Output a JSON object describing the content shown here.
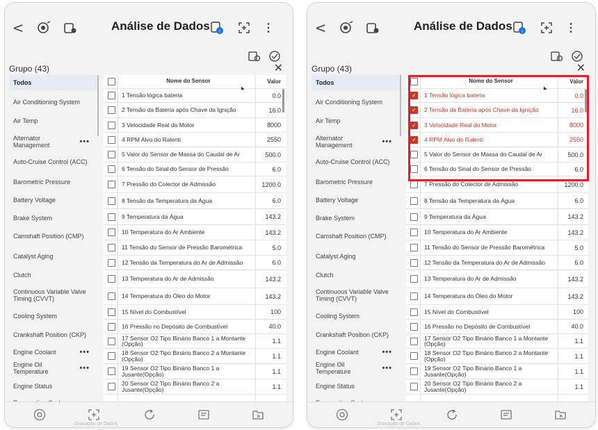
{
  "app": {
    "title": "Análise de Dados",
    "back_glyph": "<",
    "menu_glyph": "⋮",
    "close_glyph": "✕",
    "expand_glyph": "[+]",
    "group_label": "Grupo (43)",
    "icons": [
      "back-arrow-icon",
      "vci-connection-icon",
      "vehicle-info-icon",
      "document-info-icon",
      "fullscreen-icon",
      "more-menu-icon",
      "record-icon",
      "snapshot-icon",
      "close-icon"
    ]
  },
  "sidebar": {
    "items": [
      {
        "label": "Todos",
        "active": true
      },
      {
        "label": "Air Conditioning System"
      },
      {
        "label": "Air Temp"
      },
      {
        "label": "Alternator Management",
        "more": "•••"
      },
      {
        "label": "Auto-Cruise Control (ACC)"
      },
      {
        "label": "Barometric Pressure"
      },
      {
        "label": "Battery Voltage"
      },
      {
        "label": "Brake System"
      },
      {
        "label": "Camshaft Position (CMP)"
      },
      {
        "label": "Catalyst Aging"
      },
      {
        "label": "Clutch"
      },
      {
        "label": "Continuous Variable Valve Timing (CVVT)"
      },
      {
        "label": "Cooling System"
      },
      {
        "label": "Crankshaft Position (CKP)"
      },
      {
        "label": "Engine Coolant",
        "more": "•••"
      },
      {
        "label": "Engine Oil Temperature",
        "more": "•••"
      },
      {
        "label": "Engine Status"
      },
      {
        "label": "Evaporation System"
      }
    ]
  },
  "table": {
    "header_name": "Nome do Sensor",
    "header_value": "Valor",
    "rows": [
      {
        "name": "1 Tensão lógica bateria",
        "value": "0.0"
      },
      {
        "name": "2 Tensão da Bateria após Chave da Ignição",
        "value": "16.0"
      },
      {
        "name": "3 Velocidade Real do Motor",
        "value": "8000"
      },
      {
        "name": "4 RPM Alvo do Ralenti",
        "value": "2550"
      },
      {
        "name": "5 Valor do Sensor de Massa do Caudal de Ar",
        "value": "500.0"
      },
      {
        "name": "6 Tensão do Sinal do Sensor de Pressão",
        "value": "6.0"
      },
      {
        "name": "7 Pressão do Colector de Admissão",
        "value": "1200.0"
      },
      {
        "name": "8 Tensão da Temperatura da Água",
        "value": "6.0"
      },
      {
        "name": "9 Temperatura da Água",
        "value": "143.2"
      },
      {
        "name": "10 Temperatura do Ar Ambiente",
        "value": "143.2"
      },
      {
        "name": "11 Tensão do Sensor de Pressão Barométrica",
        "value": "5.0"
      },
      {
        "name": "12 Tensão da Temperatura do Ar de Admissão",
        "value": "6.0"
      },
      {
        "name": "13 Temperatura do Ar de Admissão",
        "value": "143.2"
      },
      {
        "name": "14 Temperatura do Óleo do Motor",
        "value": "143.2"
      },
      {
        "name": "15 Nível do Combustível",
        "value": "100"
      },
      {
        "name": "16 Pressão no Depósito de Combustível",
        "value": "40.0"
      },
      {
        "name": "17 Sensor O2 Tipo Binário Banco 1 a Montante (Opção)",
        "value": "1.1"
      },
      {
        "name": "18 Sensor O2 Tipo Binário Banco 2 a Montante (Opção)",
        "value": "1.1"
      },
      {
        "name": "19 Sensor O2 Tipo Binário Banco 1 a Jusante(Opção)",
        "value": "1.1"
      },
      {
        "name": "20 Sensor O2 Tipo Binário Banco 2 a Jusante(Opção)",
        "value": "1.1"
      }
    ]
  },
  "screens": [
    {
      "selected_rows": [],
      "highlight": false
    },
    {
      "selected_rows": [
        0,
        1,
        2,
        3
      ],
      "highlight": true,
      "highlight_color": "#e0202b"
    }
  ],
  "bottom_bar": {
    "caption": "Gravação de Dados",
    "icons": [
      "record-circle-icon",
      "frame-icon",
      "refresh-icon",
      "report-icon",
      "folder-icon"
    ]
  },
  "colors": {
    "accent": "#c0392b",
    "highlight": "#e0202b"
  }
}
